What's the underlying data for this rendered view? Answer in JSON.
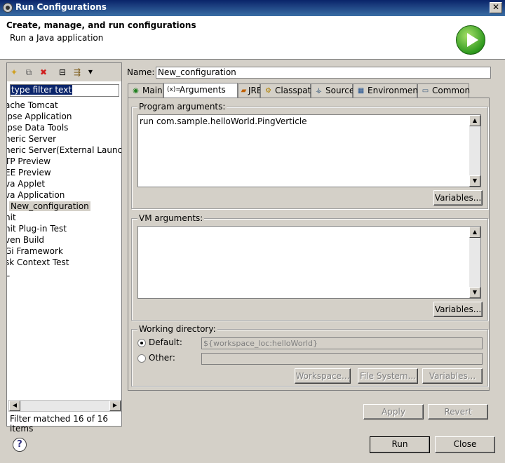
{
  "window": {
    "title": "Run Configurations",
    "close_label": "✕"
  },
  "header": {
    "title": "Create, manage, and run configurations",
    "subtitle": "Run a Java application"
  },
  "left": {
    "toolbar_icons": [
      "new-launch-config-icon",
      "duplicate-icon",
      "delete-icon",
      "collapse-all-icon",
      "filter-icon",
      "dropdown-arrow-icon"
    ],
    "filter_value": "type filter text",
    "tree": [
      "ache Tomcat",
      "ipse Application",
      "ipse Data Tools",
      "neric Server",
      "neric Server(External Launch",
      "TP Preview",
      "EE Preview",
      "va Applet",
      "va Application",
      "New_configuration",
      "nit",
      "nit Plug-in Test",
      "ven Build",
      "Gi Framework",
      "sk Context Test",
      "L"
    ],
    "selected_index": 9,
    "scroll_left": "◀",
    "scroll_right": "▶",
    "status": "Filter matched 16 of 16 items"
  },
  "name": {
    "label": "Name:",
    "value": "New_configuration"
  },
  "tabs": [
    {
      "label": "Main",
      "icon": "main-tab-icon"
    },
    {
      "label": "Arguments",
      "icon": "arguments-tab-icon"
    },
    {
      "label": "JRE",
      "icon": "jre-tab-icon"
    },
    {
      "label": "Classpath",
      "icon": "classpath-tab-icon"
    },
    {
      "label": "Source",
      "icon": "source-tab-icon"
    },
    {
      "label": "Environment",
      "icon": "environment-tab-icon"
    },
    {
      "label": "Common",
      "icon": "common-tab-icon"
    }
  ],
  "active_tab": "Arguments",
  "program_args": {
    "label": "Program arguments:",
    "value": "run com.sample.helloWorld.PingVerticle",
    "variables_button": "Variables..."
  },
  "vm_args": {
    "label": "VM arguments:",
    "value": "",
    "variables_button": "Variables..."
  },
  "working_dir": {
    "label": "Working directory:",
    "default_label": "Default:",
    "default_value": "${workspace_loc:helloWorld}",
    "other_label": "Other:",
    "other_value": "",
    "selected": "Default",
    "workspace_button": "Workspace...",
    "filesystem_button": "File System...",
    "variables_button": "Variables..."
  },
  "actions": {
    "apply": "Apply",
    "revert": "Revert"
  },
  "footer": {
    "help": "?",
    "run": "Run",
    "close": "Close"
  },
  "colors": {
    "title_bar": "#0a246a",
    "face": "#d4d0c8",
    "run_green": "#2f9a1e"
  }
}
